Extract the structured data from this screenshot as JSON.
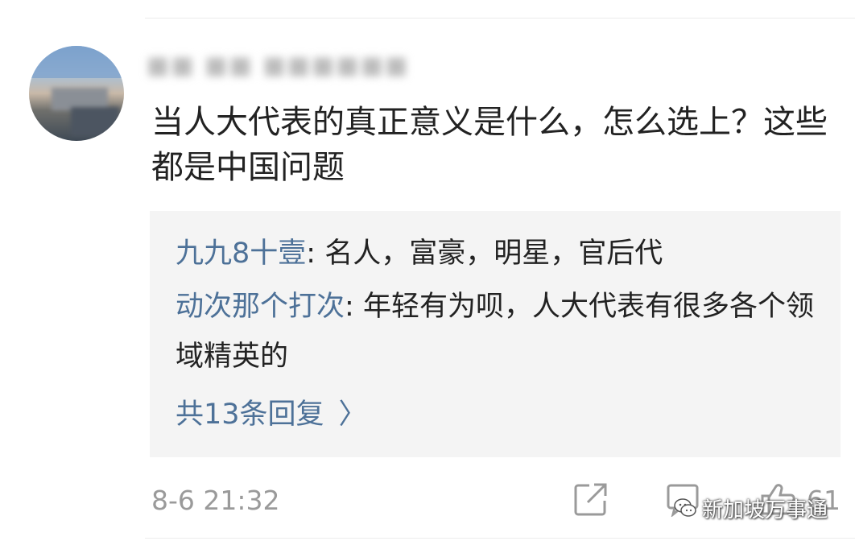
{
  "comment": {
    "username": "■■ ■■ ■■■■■■",
    "text": "当人大代表的真正意义是什么，怎么选上？这些都是中国问题",
    "timestamp": "8-6 21:32",
    "like_count": "61"
  },
  "replies": {
    "items": [
      {
        "author": "九九8十壹",
        "separator": ": ",
        "text": "名人，富豪，明星，官后代"
      },
      {
        "author": "动次那个打次",
        "separator": ": ",
        "text": "年轻有为呗，人大代表有很多各个领域精英的"
      }
    ],
    "more_label": "共13条回复",
    "more_chevron": "〉"
  },
  "watermark": {
    "text": "新加坡万事通"
  },
  "icons": {
    "share": "share-icon",
    "comment": "comment-icon",
    "like": "thumbs-up-icon",
    "watermark_logo": "wechat-icon"
  },
  "colors": {
    "author_link": "#4d7198",
    "reply_background": "#f4f4f4",
    "meta_gray": "#9a9a9a",
    "text": "#222222"
  }
}
